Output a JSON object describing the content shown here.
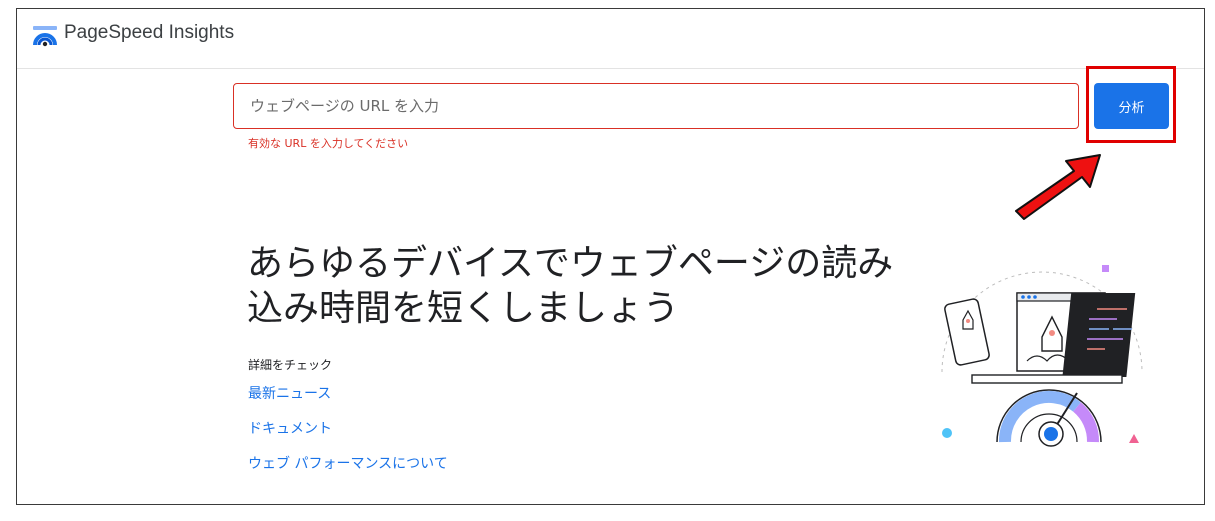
{
  "header": {
    "brand": "PageSpeed Insights",
    "logo_icon": "pagespeed-gauge-icon"
  },
  "search": {
    "placeholder": "ウェブページの URL を入力",
    "value": "",
    "error": "有効な URL を入力してください",
    "button_label": "分析"
  },
  "hero": {
    "headline_line1": "あらゆるデバイスでウェブページの読み",
    "headline_line2": "込み時間を短くしましょう"
  },
  "links": {
    "section_label": "詳細をチェック",
    "items": [
      {
        "label": "最新ニュース"
      },
      {
        "label": "ドキュメント"
      },
      {
        "label": "ウェブ パフォーマンスについて"
      }
    ]
  },
  "colors": {
    "accent": "#1a73e8",
    "error": "#d93025",
    "annotation": "#e00000"
  },
  "annotation": {
    "arrow_icon": "red-arrow-icon"
  }
}
